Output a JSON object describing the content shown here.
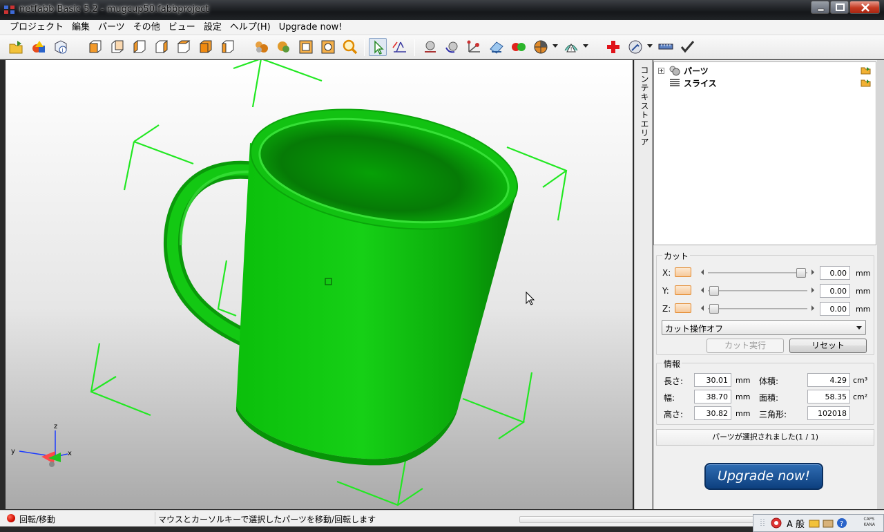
{
  "window": {
    "title": "netfabb Basic 5.2 - mugcup50.fabbproject"
  },
  "menu": [
    "プロジェクト",
    "編集",
    "パーツ",
    "その他",
    "ビュー",
    "設定",
    "ヘルプ(H)",
    "Upgrade now!"
  ],
  "context_tab": {
    "label": "コンテキストエリア"
  },
  "tree": {
    "items": [
      {
        "label": "パーツ",
        "icon": "parts-icon"
      },
      {
        "label": "スライス",
        "icon": "slice-icon"
      }
    ]
  },
  "cut": {
    "title": "カット",
    "axes": [
      {
        "label": "X:",
        "value": "0.00",
        "unit": "mm",
        "slider_fraction": 1.0
      },
      {
        "label": "Y:",
        "value": "0.00",
        "unit": "mm",
        "slider_fraction": 0.0
      },
      {
        "label": "Z:",
        "value": "0.00",
        "unit": "mm",
        "slider_fraction": 0.0
      }
    ],
    "mode_selected": "カット操作オフ",
    "execute_label": "カット実行",
    "reset_label": "リセット"
  },
  "info": {
    "title": "情報",
    "length_label": "長さ:",
    "length_value": "30.01",
    "width_label": "幅:",
    "width_value": "38.70",
    "height_label": "高さ:",
    "height_value": "30.82",
    "mm": "mm",
    "volume_label": "体積:",
    "volume_value": "4.29",
    "volume_unit": "cm³",
    "area_label": "面積:",
    "area_value": "58.35",
    "area_unit": "cm²",
    "triangles_label": "三角形:",
    "triangles_value": "102018"
  },
  "selection_status": "パーツが選択されました(1 / 1)",
  "upgrade_label": "Upgrade now!",
  "statusbar": {
    "mode": "回転/移動",
    "message": "マウスとカーソルキーで選択したパーツを移動/回転します"
  },
  "axis_gizmo": {
    "x": "x",
    "y": "y",
    "z": "z"
  },
  "ime": {
    "mode": "A 般",
    "caps": "CAPS",
    "kana": "KANA"
  },
  "colors": {
    "model": "#12c212",
    "bbox": "#22e822",
    "upgrade": "#0d3f7e"
  }
}
